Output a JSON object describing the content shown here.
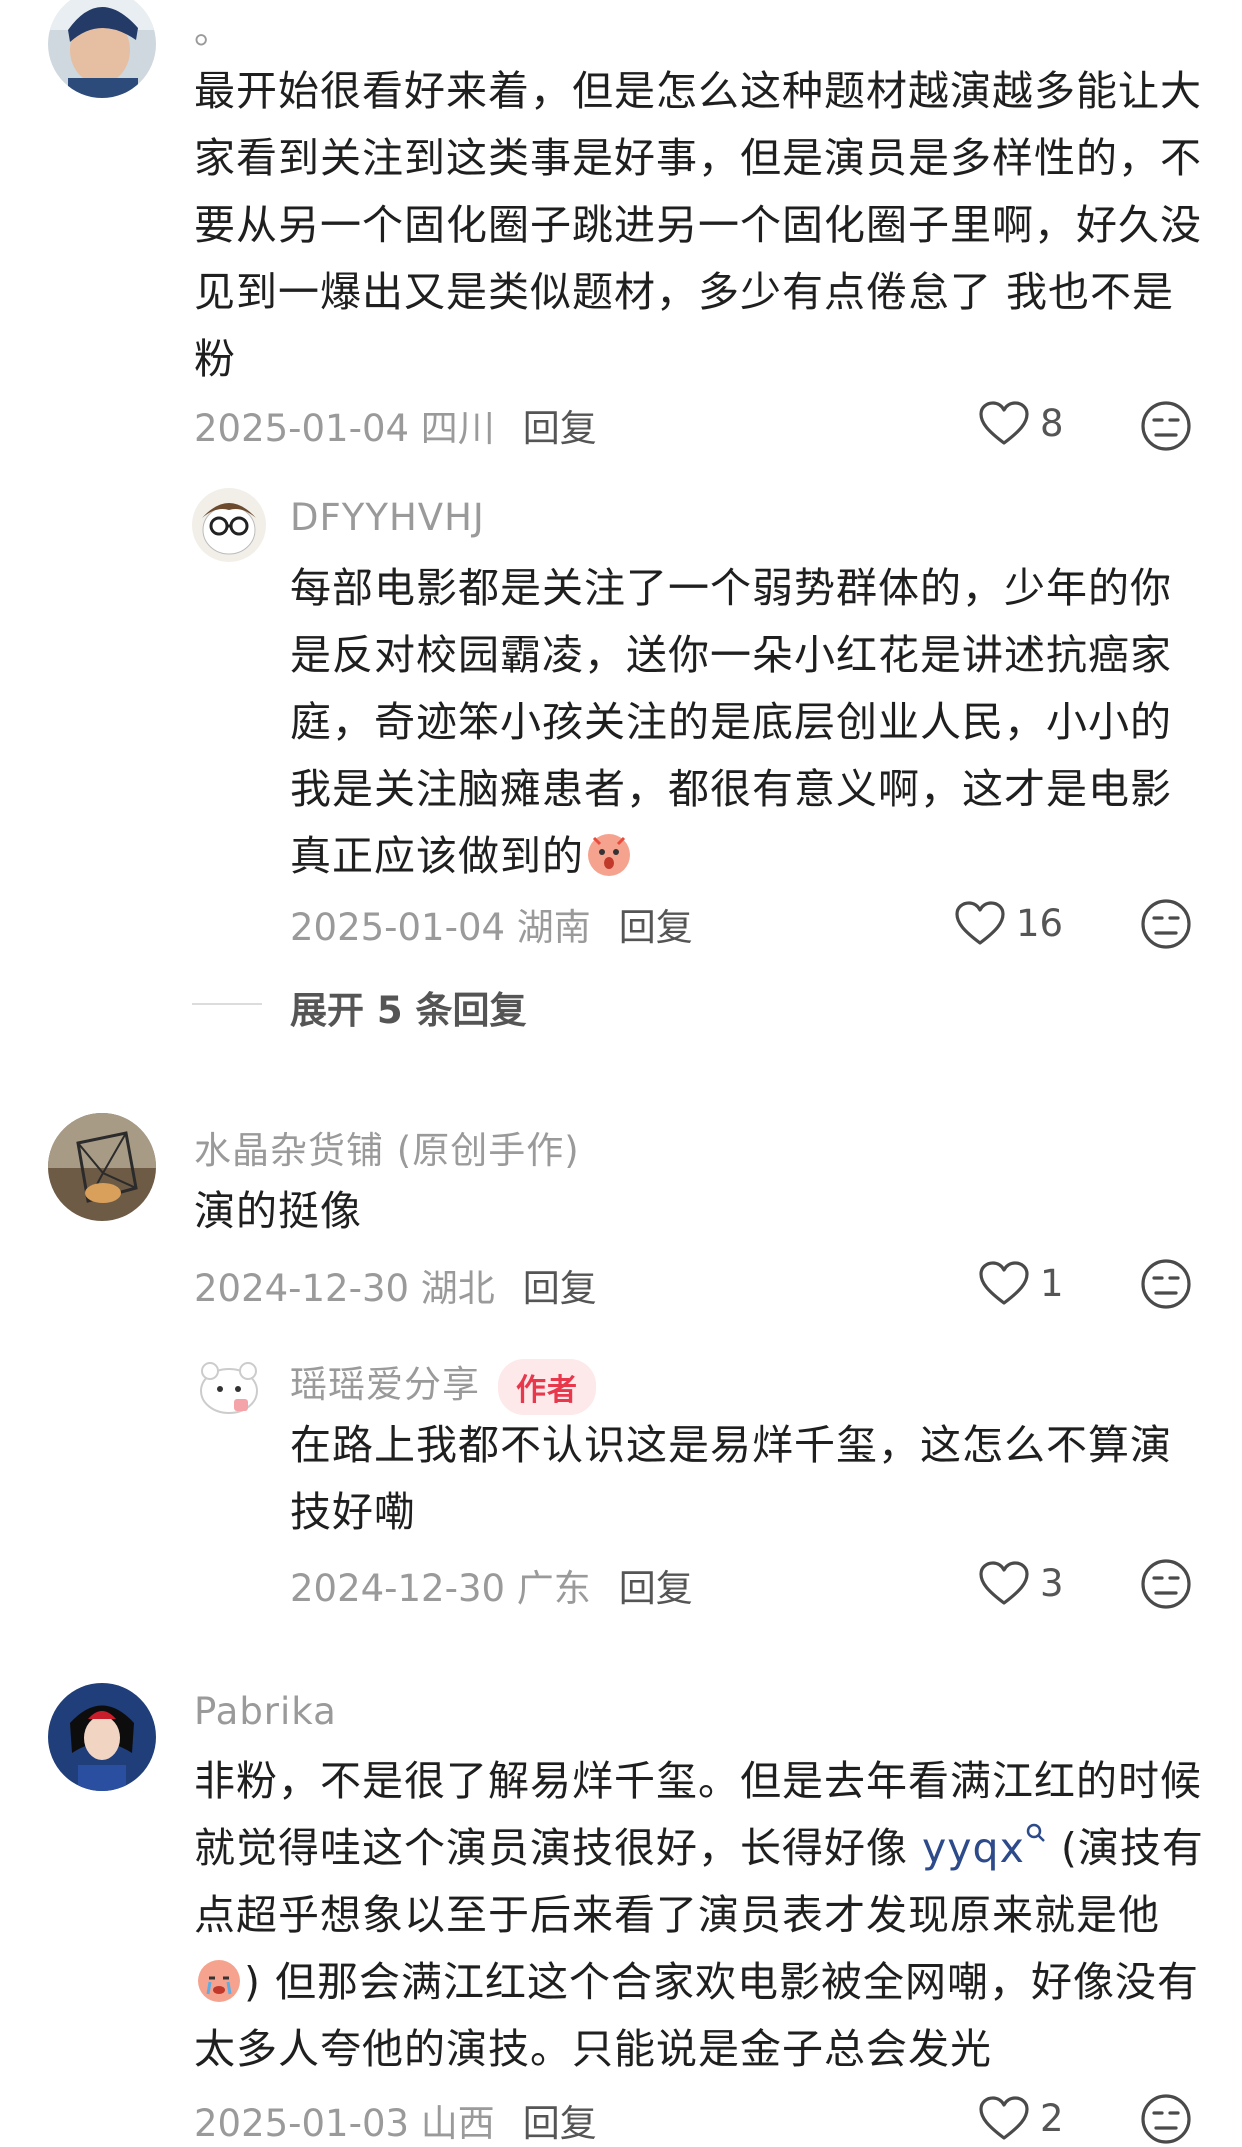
{
  "comments": [
    {
      "username": "。",
      "text": "最开始很看好来着，但是怎么这种题材越演越多能让大家看到关注到这类事是好事，但是演员是多样性的，不要从另一个固化圈子跳进另一个固化圈子里啊，好久没见到一爆出又是类似题材，多少有点倦怠了 我也不是粉",
      "date_location": "2025-01-04 四川",
      "reply_label": "回复",
      "likes": "8",
      "replies": [
        {
          "username": "DFYYHVHJ",
          "text": "每部电影都是关注了一个弱势群体的，少年的你是反对校园霸凌，送你一朵小红花是讲述抗癌家庭，奇迹笨小孩关注的是底层创业人民，小小的我是关注脑瘫患者，都很有意义啊，这才是电影真正应该做到的",
          "date_location": "2025-01-04 湖南",
          "reply_label": "回复",
          "likes": "16"
        }
      ],
      "expand_label": "展开 5 条回复"
    },
    {
      "username": "水晶杂货铺 (原创手作)",
      "text": "演的挺像",
      "date_location": "2024-12-30 湖北",
      "reply_label": "回复",
      "likes": "1",
      "replies": [
        {
          "username": "瑶瑶爱分享",
          "badge": "作者",
          "text": "在路上我都不认识这是易烊千玺，这怎么不算演技好嘞",
          "date_location": "2024-12-30 广东",
          "reply_label": "回复",
          "likes": "3"
        }
      ]
    },
    {
      "username": "Pabrika",
      "text_part1": "非粉，不是很了解易烊千玺。但是去年看满江红的时候就觉得哇这个演员演技很好，长得好像 ",
      "link_text": "yyqx",
      "text_part2": " (演技有点超乎想象以至于后来看了演员表才发现原来就是他",
      "text_part3": ") 但那会满江红这个合家欢电影被全网嘲，好像没有太多人夸他的演技。只能说是金子总会发光",
      "date_location": "2025-01-03 山西",
      "reply_label": "回复",
      "likes": "2"
    }
  ],
  "colors": {
    "text": "#1f1f1f",
    "meta": "#9a9a9a",
    "link": "#2d4b8a",
    "author_badge_bg": "#fde8ea",
    "author_badge_text": "#e8384c"
  },
  "icons": [
    "heart-icon",
    "dislike-face-icon",
    "search-link-icon"
  ]
}
